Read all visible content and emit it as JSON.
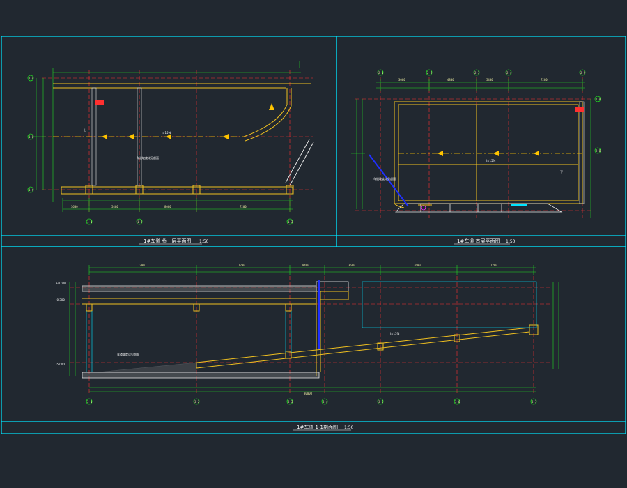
{
  "colors": {
    "background": "#212830",
    "frame": "#00e5ff",
    "wall": "#f0c020",
    "axis": "#ff3030",
    "dimension": "#22dd22",
    "arrow": "#ffc400",
    "column": "#e6e6e6",
    "ramp_diag": "#2030ff"
  },
  "titles": {
    "plan_minus1": "1#车道 负一层平面图",
    "plan_minus1_scale": "1:50",
    "plan_ground": "1#车道 首层平面图",
    "plan_ground_scale": "1:50",
    "section": "1#车道 1-1剖面图",
    "section_scale": "1:50"
  },
  "axes": {
    "plan1_bottom": [
      "1-1",
      "1-2",
      "1-3"
    ],
    "plan1_left": [
      "1-A",
      "1-B",
      "1-C"
    ],
    "plan2_top": [
      "2-1",
      "2-2",
      "2-3",
      "2-4",
      "2-5"
    ],
    "plan2_right": [
      "2-A",
      "2-B"
    ],
    "section_bottom": [
      "3-1",
      "3-2",
      "3-3",
      "3-4",
      "3-5",
      "3-6",
      "3-7"
    ]
  },
  "dimensions": {
    "plan1_bottom": [
      "3600",
      "5400",
      "8000",
      "7200"
    ],
    "plan2_top": [
      "3000",
      "4800",
      "5400",
      "7200"
    ],
    "section_top": [
      "7200",
      "7200",
      "8400",
      "3600",
      "3600",
      "7200"
    ],
    "section_bottom": [
      "30000"
    ]
  },
  "tags": {
    "slope": "i=15%",
    "up": "上",
    "down": "下",
    "level_1": "-5.000",
    "level_2": "±0.000",
    "level_3": "-0.300",
    "ramp_note": "车道坡度详见剖面"
  }
}
